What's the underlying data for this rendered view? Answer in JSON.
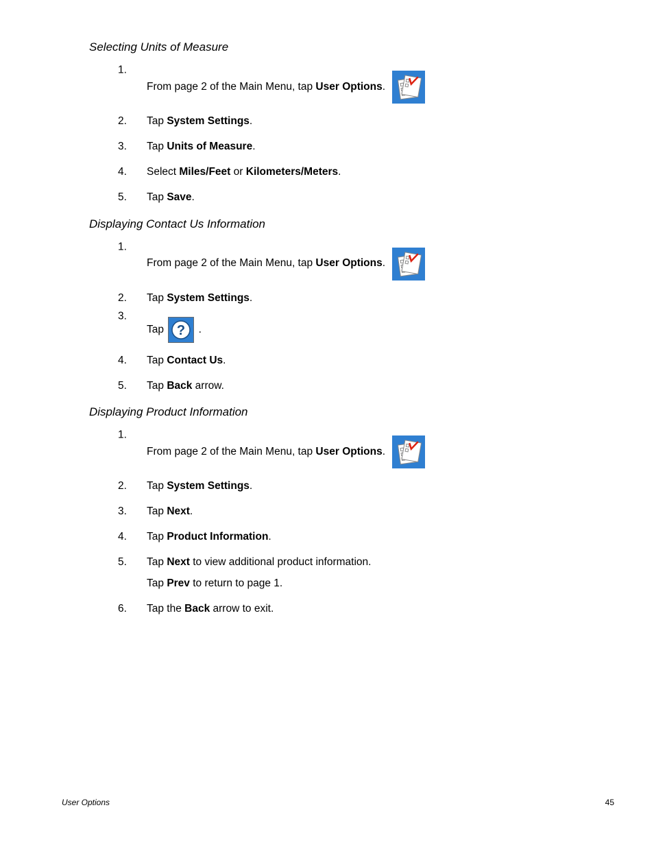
{
  "footer": {
    "section": "User Options",
    "page": "45"
  },
  "sections": [
    {
      "heading": "Selecting Units of Measure",
      "steps": [
        {
          "n": "1.",
          "pre": "From page 2 of the Main Menu, tap ",
          "bold": "User Options",
          "post": ".",
          "icon": "opts"
        },
        {
          "n": "2.",
          "pre": "Tap ",
          "bold": "System Settings",
          "post": "."
        },
        {
          "n": "3.",
          "pre": "Tap ",
          "bold": "Units of Measure",
          "post": "."
        },
        {
          "n": "4.",
          "pre": "Select ",
          "bold": "Miles/Feet",
          "mid": " or ",
          "bold2": "Kilometers/Meters",
          "post": "."
        },
        {
          "n": "5.",
          "pre": "Tap ",
          "bold": "Save",
          "post": "."
        }
      ]
    },
    {
      "heading": "Displaying Contact Us Information",
      "steps": [
        {
          "n": "1.",
          "pre": "From page 2 of the Main Menu, tap ",
          "bold": "User Options",
          "post": ".",
          "icon": "opts"
        },
        {
          "n": "2.",
          "pre": "Tap ",
          "bold": "System Settings",
          "post": "."
        },
        {
          "n": "3.",
          "pre": "Tap ",
          "inlineHelp": true,
          "post": "."
        },
        {
          "n": "4.",
          "pre": "Tap ",
          "bold": "Contact Us",
          "post": "."
        },
        {
          "n": "5.",
          "pre": "Tap ",
          "bold": "Back",
          "post": " arrow."
        }
      ]
    },
    {
      "heading": "Displaying Product Information",
      "steps": [
        {
          "n": "1.",
          "pre": "From page 2 of the Main Menu, tap ",
          "bold": "User Options",
          "post": ".",
          "icon": "opts"
        },
        {
          "n": "2.",
          "pre": "Tap ",
          "bold": "System Settings",
          "post": "."
        },
        {
          "n": "3.",
          "pre": "Tap ",
          "bold": "Next",
          "post": "."
        },
        {
          "n": "4.",
          "pre": "Tap ",
          "bold": "Product Information",
          "post": "."
        },
        {
          "n": "5.",
          "pre": "Tap ",
          "bold": "Next",
          "post": " to view additional product information.",
          "extraPre": "Tap ",
          "extraBold": "Prev",
          "extraPost": " to return to page 1."
        },
        {
          "n": "6.",
          "pre": "Tap the ",
          "bold": "Back",
          "post": " arrow to exit."
        }
      ]
    }
  ]
}
